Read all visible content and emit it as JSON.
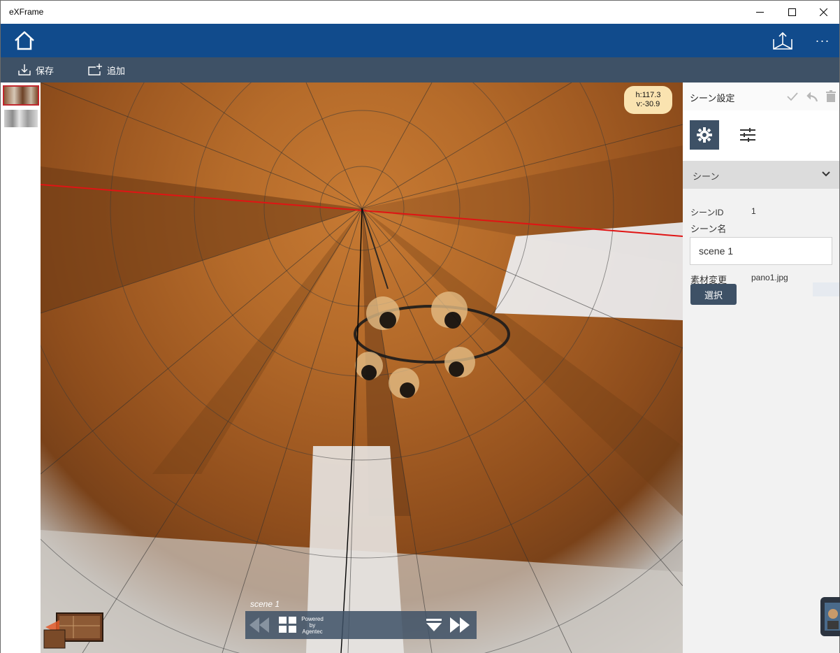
{
  "window": {
    "title": "eXFrame"
  },
  "header": {
    "home_icon": "home-icon",
    "share_icon": "share-icon",
    "more_icon": "more-icon",
    "more_label": "···"
  },
  "toolbar": {
    "save_label": "保存",
    "add_label": "追加"
  },
  "viewer": {
    "coords": {
      "h": "h:117.3",
      "v": "v:-30.9"
    },
    "scene_caption": "scene 1",
    "powered": [
      "Powered",
      "by",
      "Agentec"
    ]
  },
  "panel": {
    "title": "シーン設定",
    "section_label": "シーン",
    "scene_id_label": "シーンID",
    "scene_id_value": "1",
    "scene_name_label": "シーン名",
    "scene_name_value": "scene 1",
    "material_label": "素材変更",
    "material_value": "pano1.jpg",
    "select_label": "選択"
  },
  "colors": {
    "header": "#114b8c",
    "toolbar": "#3e5166",
    "selected_thumb": "#c1272d",
    "coord_badge": "#fae3b0"
  }
}
